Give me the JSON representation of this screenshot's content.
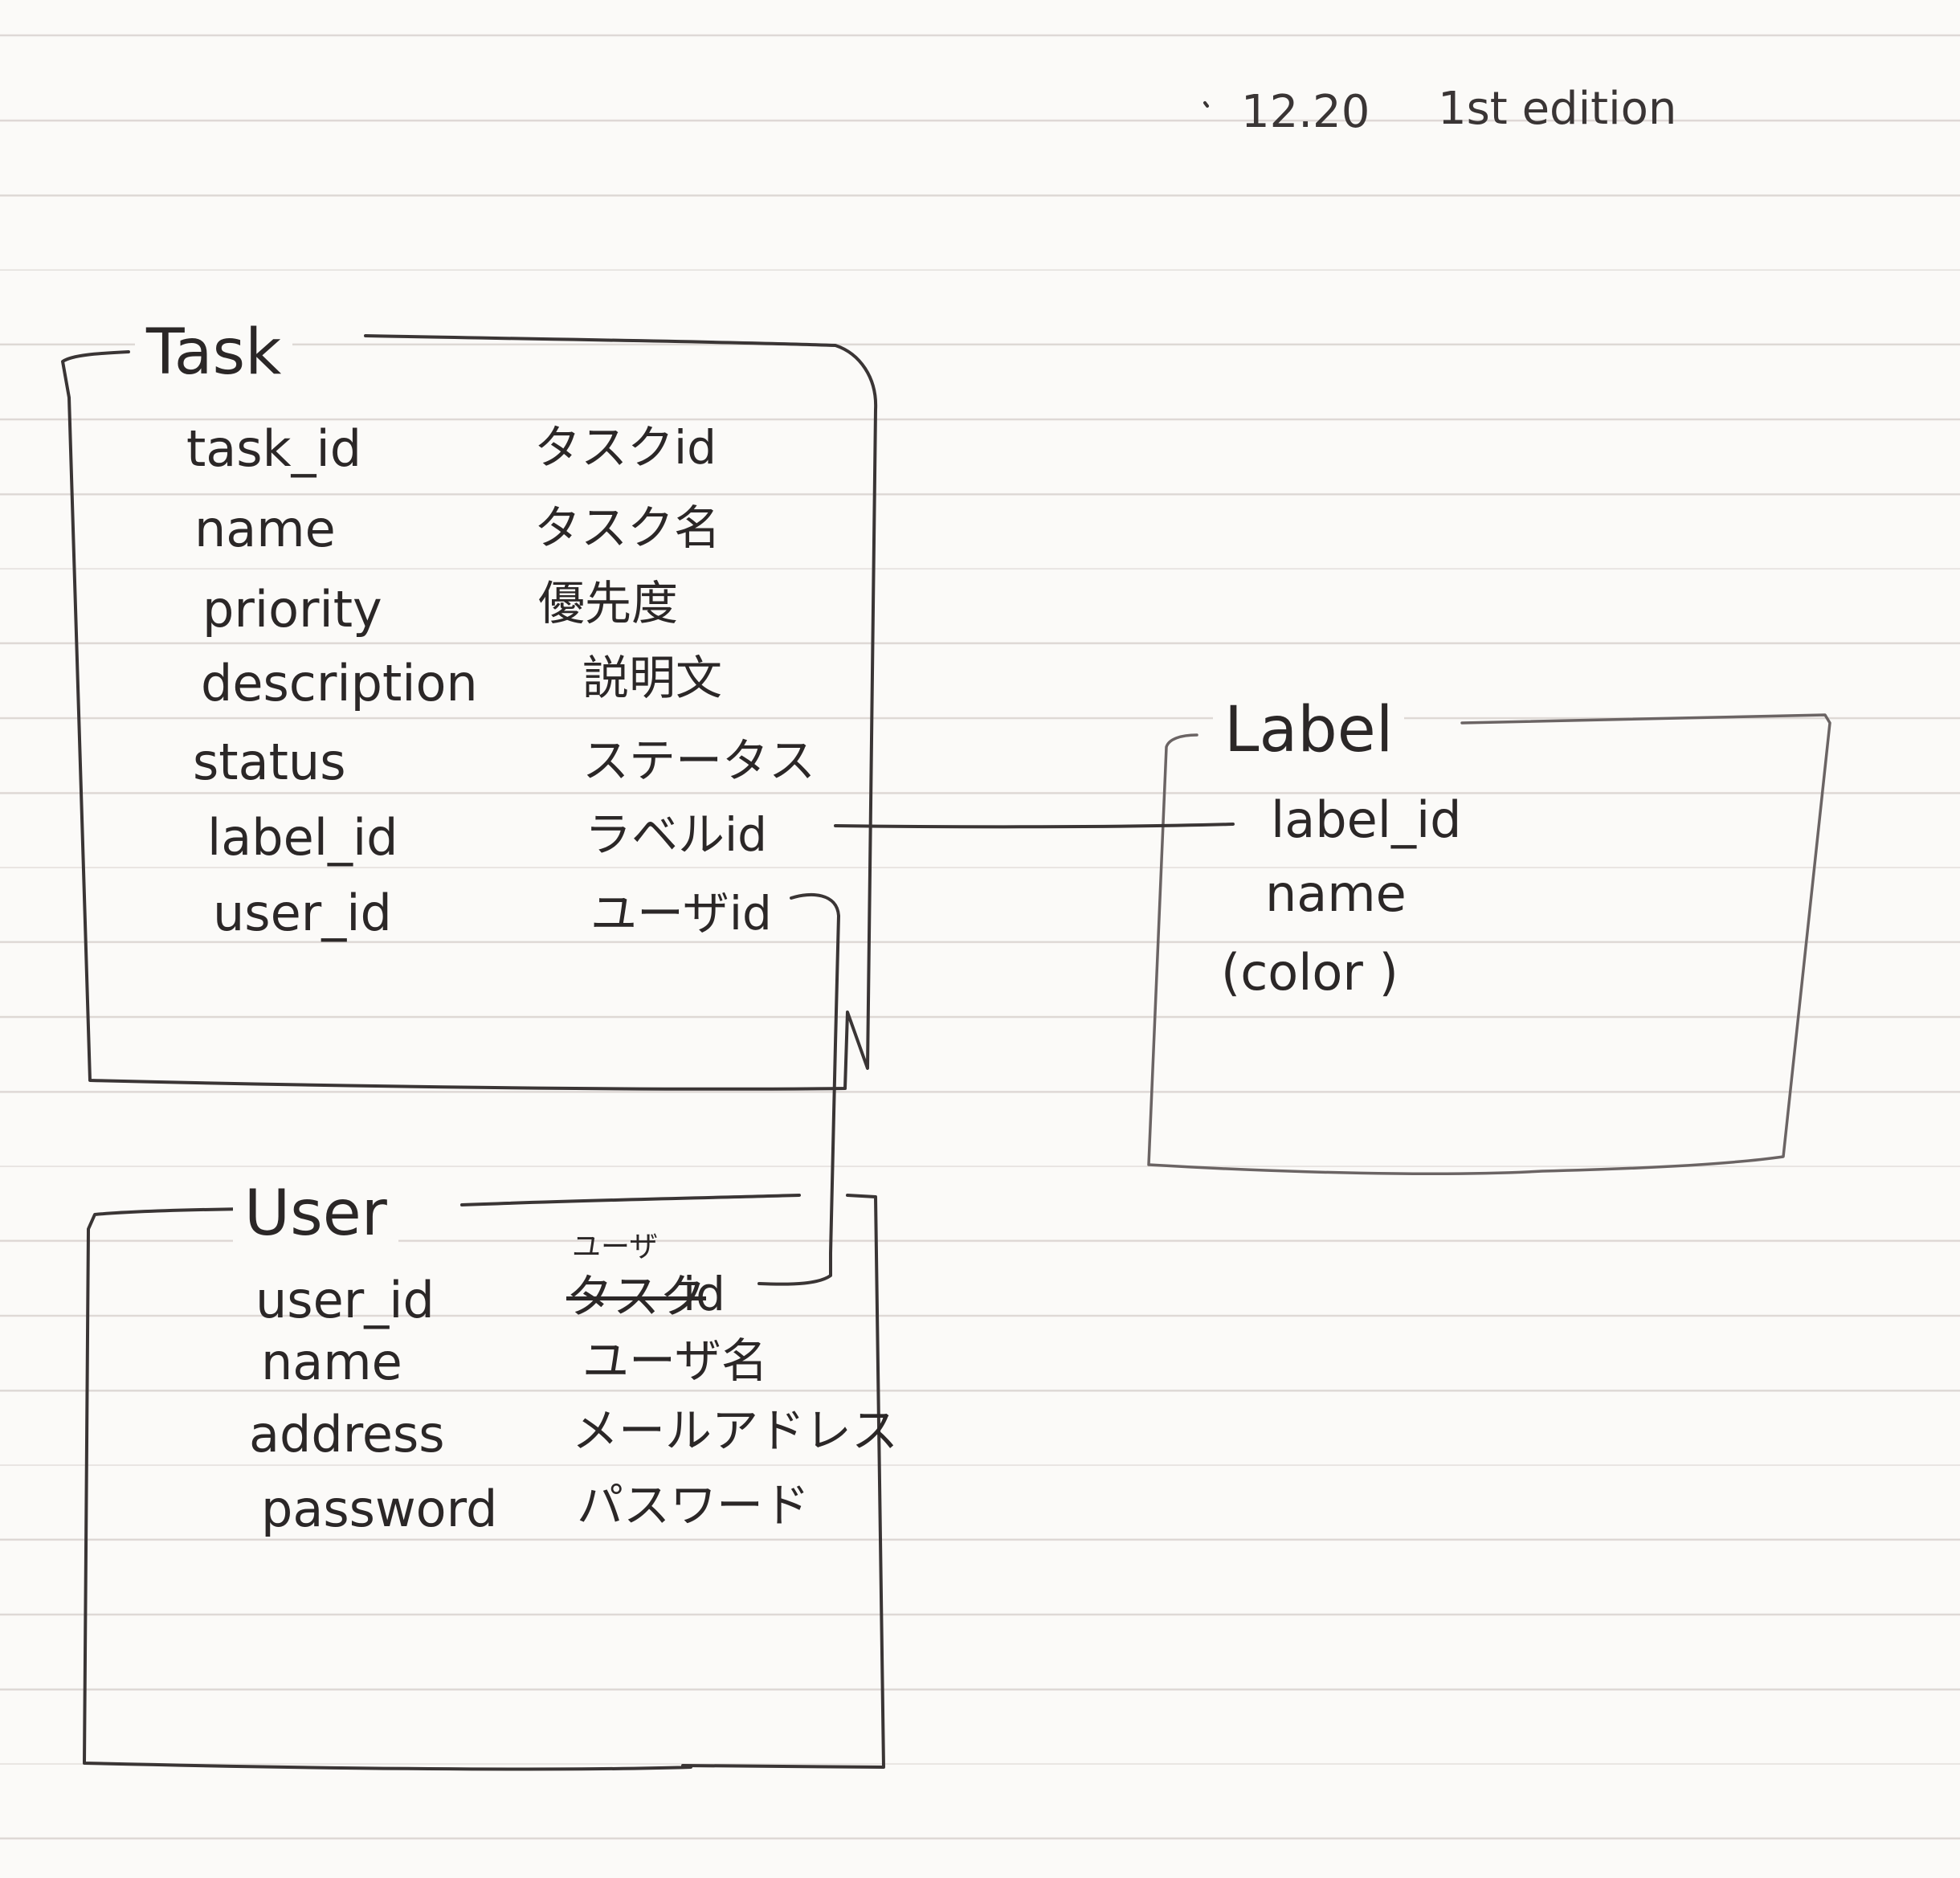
{
  "note": {
    "date": "12.20",
    "edition": "1st edition"
  },
  "entities": {
    "task": {
      "title": "Task",
      "fields": [
        {
          "name": "task_id",
          "desc": "タスクid"
        },
        {
          "name": "name",
          "desc": "タスク名"
        },
        {
          "name": "priority",
          "desc": "優先度"
        },
        {
          "name": "description",
          "desc": "説明文"
        },
        {
          "name": "status",
          "desc": "ステータス"
        },
        {
          "name": "label_id",
          "desc": "ラベルid"
        },
        {
          "name": "user_id",
          "desc": "ユーザid"
        }
      ]
    },
    "label": {
      "title": "Label",
      "fields": [
        {
          "name": "label_id"
        },
        {
          "name": "name"
        },
        {
          "name": "(color )"
        }
      ]
    },
    "user": {
      "title": "User",
      "fields": [
        {
          "name": "user_id",
          "desc_struck": "タスク",
          "desc_correction": "ユーザ",
          "desc": "id"
        },
        {
          "name": "name",
          "desc": "ユーザ名"
        },
        {
          "name": "address",
          "desc": "メールアドレス"
        },
        {
          "name": "password",
          "desc": "パスワード"
        }
      ]
    }
  },
  "relations": [
    {
      "from": "task.label_id",
      "to": "label.label_id"
    },
    {
      "from": "task.user_id",
      "to": "user.user_id"
    }
  ]
}
